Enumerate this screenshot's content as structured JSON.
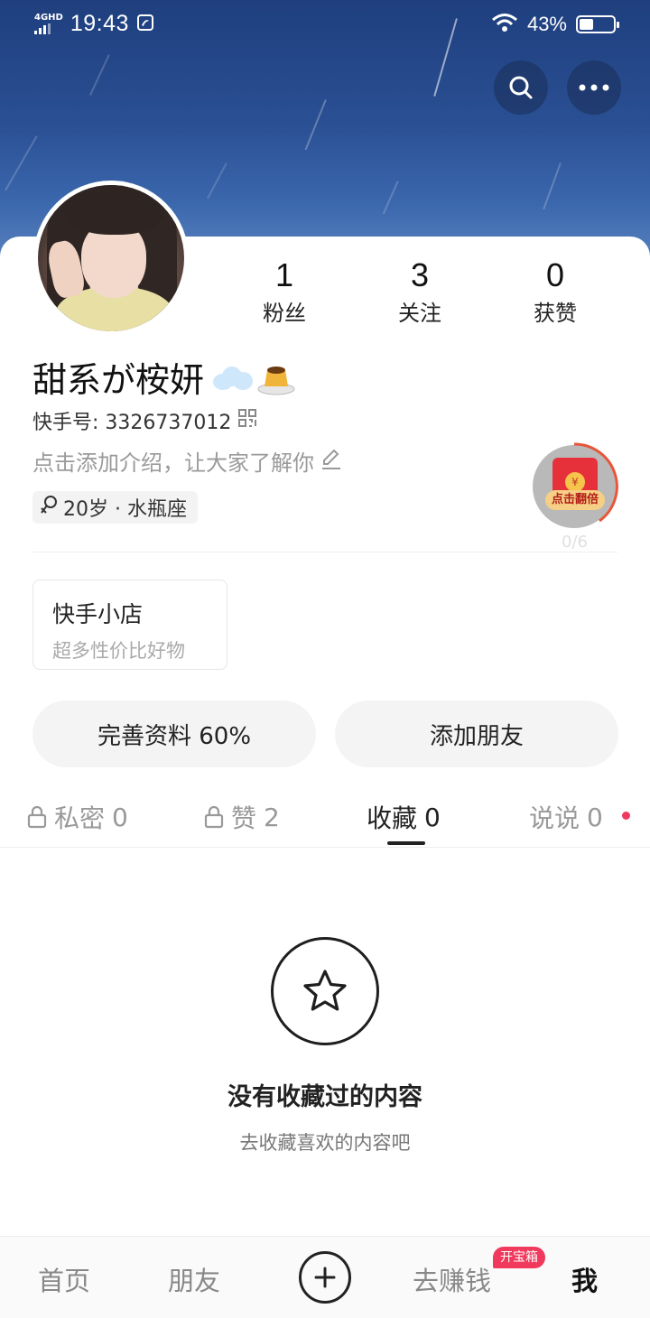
{
  "status_bar": {
    "network": "4GHD",
    "time": "19:43",
    "battery_text": "43%",
    "battery_level": 0.43
  },
  "header": {
    "search_icon": "search-icon",
    "more_icon": "more-icon"
  },
  "profile": {
    "username": "甜系が桉妍",
    "username_emojis": [
      "cloud-emoji",
      "pudding-emoji"
    ],
    "id_label": "快手号: 3326737012",
    "intro_placeholder": "点击添加介绍，让大家了解你",
    "tag": "20岁 · 水瓶座",
    "gender_icon": "female-icon"
  },
  "stats": [
    {
      "value": "1",
      "label": "粉丝"
    },
    {
      "value": "3",
      "label": "关注"
    },
    {
      "value": "0",
      "label": "获赞"
    }
  ],
  "red_packet": {
    "label": "点击翻倍",
    "progress": "0/6",
    "accent": "#e8553a"
  },
  "shop": {
    "title": "快手小店",
    "subtitle": "超多性价比好物"
  },
  "actions": {
    "complete_profile": "完善资料 60%",
    "add_friends": "添加朋友"
  },
  "tabs": [
    {
      "label": "私密",
      "count": "0",
      "locked": true
    },
    {
      "label": "赞",
      "count": "2",
      "locked": true
    },
    {
      "label": "收藏",
      "count": "0",
      "active": true
    },
    {
      "label": "说说",
      "count": "0",
      "dot": true
    }
  ],
  "empty_state": {
    "icon": "star-icon",
    "title": "没有收藏过的内容",
    "subtitle": "去收藏喜欢的内容吧"
  },
  "bottom_nav": {
    "home": "首页",
    "friends": "朋友",
    "earn": "去赚钱",
    "earn_badge": "开宝箱",
    "me": "我"
  },
  "colors": {
    "accent_red": "#f0395c",
    "banner_blue": "#2a4f93"
  }
}
